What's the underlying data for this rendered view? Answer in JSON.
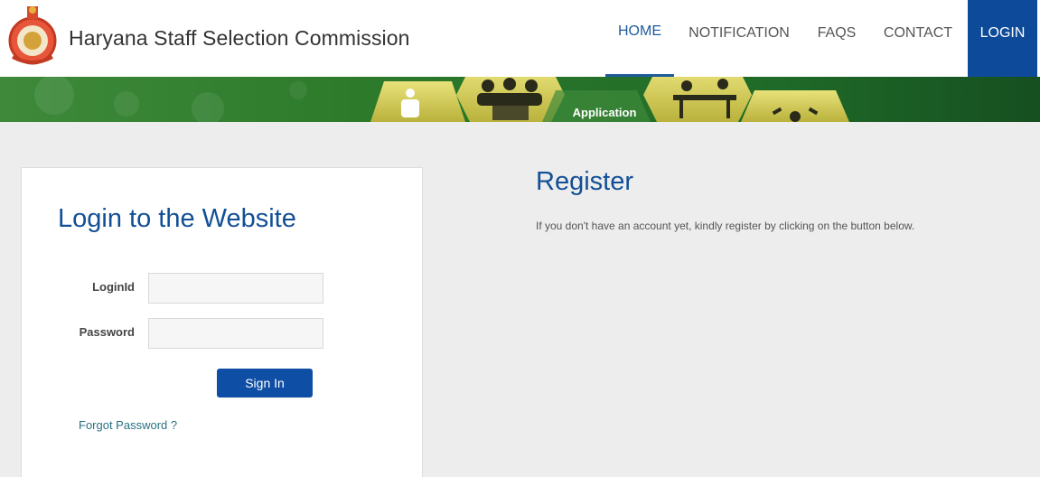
{
  "header": {
    "site_title": "Haryana Staff Selection Commission",
    "logo_icon": "haryana-emblem-icon"
  },
  "nav": {
    "items": [
      {
        "label": "HOME",
        "active": true
      },
      {
        "label": "NOTIFICATION",
        "active": false
      },
      {
        "label": "FAQS",
        "active": false
      },
      {
        "label": "CONTACT",
        "active": false
      },
      {
        "label": "LOGIN",
        "active": false,
        "highlighted": true
      }
    ]
  },
  "banner": {
    "hex_label": "Application"
  },
  "login": {
    "title": "Login to the Website",
    "loginid_label": "LoginId",
    "loginid_value": "",
    "password_label": "Password",
    "password_value": "",
    "signin_label": "Sign In",
    "forgot_label": "Forgot Password ?"
  },
  "register": {
    "title": "Register",
    "text": "If you don't have an account yet, kindly register by clicking on the button below."
  },
  "colors": {
    "brand_blue": "#0e4a9a",
    "title_blue": "#124f96",
    "banner_green": "#2f7a2f",
    "hex_yellow": "#d6d05a"
  }
}
